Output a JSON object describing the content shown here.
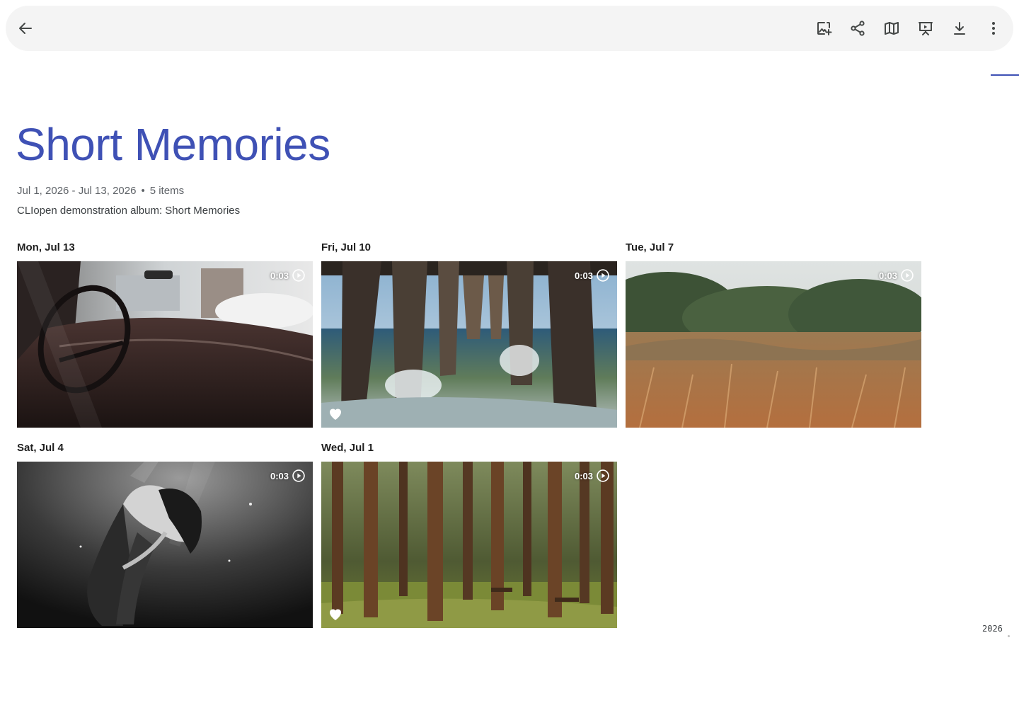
{
  "album": {
    "title": "Short Memories",
    "date_range": "Jul 1, 2026 - Jul 13, 2026",
    "separator": "•",
    "item_count": "5 items",
    "description": "CLIopen demonstration album: Short Memories"
  },
  "toolbar": {
    "back_icon": "arrow-back-icon",
    "actions": [
      "add-photos-icon",
      "share-icon",
      "map-icon",
      "slideshow-icon",
      "download-icon",
      "more-vert-icon"
    ]
  },
  "days": [
    {
      "label": "Mon, Jul 13",
      "duration": "0:03",
      "favorite": false,
      "scene": "vintage car interior"
    },
    {
      "label": "Fri, Jul 10",
      "duration": "0:03",
      "favorite": true,
      "scene": "under the pier"
    },
    {
      "label": "Tue, Jul 7",
      "duration": "0:03",
      "favorite": false,
      "scene": "dry grass field"
    },
    {
      "label": "Sat, Jul 4",
      "duration": "0:03",
      "favorite": false,
      "scene": "underwater figure"
    },
    {
      "label": "Wed, Jul 1",
      "duration": "0:03",
      "favorite": true,
      "scene": "pine forest"
    }
  ],
  "scrubber": {
    "year": "2026"
  },
  "colors": {
    "accent": "#3f51b5",
    "toolbar_bg": "#f4f4f4"
  }
}
